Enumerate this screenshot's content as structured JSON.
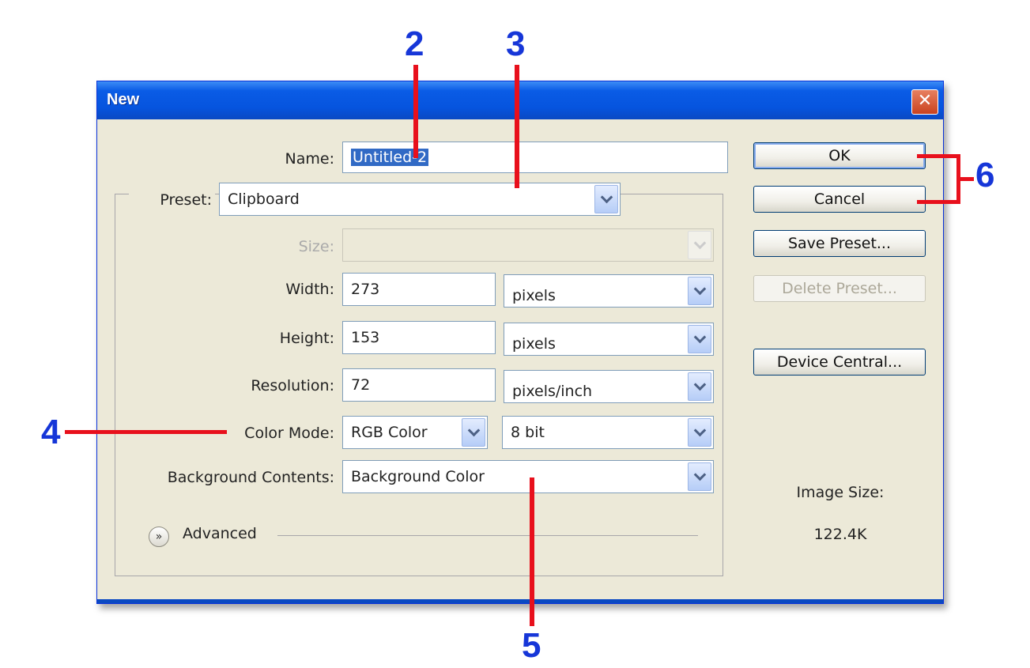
{
  "window": {
    "title": "New",
    "close_glyph": "✕"
  },
  "form": {
    "name_label": "Name:",
    "name_value": "Untitled-2",
    "preset_label": "Preset:",
    "preset_value": "Clipboard",
    "size_label": "Size:",
    "size_value": "",
    "width_label": "Width:",
    "width_value": "273",
    "width_unit": "pixels",
    "height_label": "Height:",
    "height_value": "153",
    "height_unit": "pixels",
    "resolution_label": "Resolution:",
    "resolution_value": "72",
    "resolution_unit": "pixels/inch",
    "color_mode_label": "Color Mode:",
    "color_mode_value": "RGB Color",
    "bit_depth_value": "8 bit",
    "background_label": "Background Contents:",
    "background_value": "Background Color",
    "advanced_label": "Advanced",
    "advanced_icon": "double-chevron-down-icon"
  },
  "buttons": {
    "ok": "OK",
    "cancel": "Cancel",
    "save_preset": "Save Preset...",
    "delete_preset": "Delete Preset...",
    "device_central": "Device Central..."
  },
  "info": {
    "image_size_label": "Image Size:",
    "image_size_value": "122.4K"
  },
  "annotations": {
    "n2": "2",
    "n3": "3",
    "n4": "4",
    "n5": "5",
    "n6": "6"
  },
  "colors": {
    "title_bar": "#0a5ce6",
    "dialog_bg": "#ece9d8",
    "annotation_line": "#e8101c",
    "annotation_number": "#1636d8",
    "selection": "#316ac5"
  }
}
